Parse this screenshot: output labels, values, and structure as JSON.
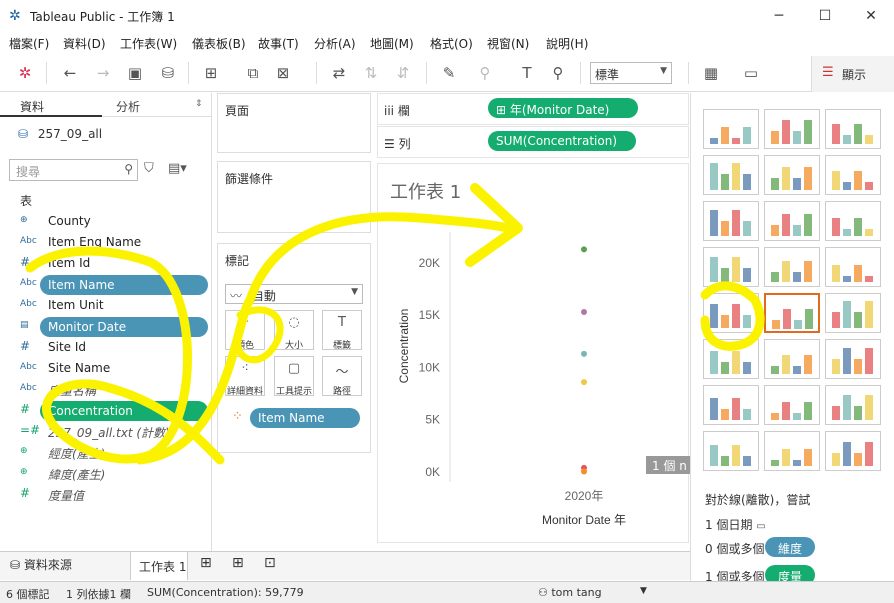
{
  "window": {
    "title": "Tableau Public - 工作簿 1"
  },
  "menu": [
    "檔案(F)",
    "資料(D)",
    "工作表(W)",
    "儀表板(B)",
    "故事(T)",
    "分析(A)",
    "地圖(M)",
    "格式(O)",
    "視窗(N)",
    "說明(H)"
  ],
  "toolbar": {
    "standard": "標準",
    "show_me": "顯示"
  },
  "left": {
    "tab_data": "資料",
    "tab_analysis": "分析",
    "datasource": "257_09_all",
    "search_placeholder": "搜尋",
    "table_header": "表",
    "fields": [
      {
        "icon": "⊕",
        "label": "County",
        "italic": false,
        "type": "geo"
      },
      {
        "icon": "Abc",
        "label": "Item Eng Name",
        "italic": false,
        "type": "dim"
      },
      {
        "icon": "#",
        "label": "Item Id",
        "italic": false,
        "type": "dim"
      },
      {
        "icon": "Abc",
        "label": "Item Name",
        "italic": false,
        "type": "dim",
        "pill": "blue"
      },
      {
        "icon": "Abc",
        "label": "Item Unit",
        "italic": false,
        "type": "dim"
      },
      {
        "icon": "▤",
        "label": "Monitor Date",
        "italic": false,
        "type": "date",
        "pill": "blue"
      },
      {
        "icon": "#",
        "label": "Site Id",
        "italic": false,
        "type": "dim"
      },
      {
        "icon": "Abc",
        "label": "Site Name",
        "italic": false,
        "type": "dim"
      },
      {
        "icon": "Abc",
        "label": "度量名稱",
        "italic": true,
        "type": "dim"
      },
      {
        "icon": "#",
        "label": "Concentration",
        "italic": false,
        "type": "measure",
        "pill": "green"
      },
      {
        "icon": "=#",
        "label": "257_09_all.txt (計數)",
        "italic": true,
        "type": "measure"
      },
      {
        "icon": "⊕",
        "label": "經度(產生)",
        "italic": true,
        "type": "measure"
      },
      {
        "icon": "⊕",
        "label": "緯度(產生)",
        "italic": true,
        "type": "measure"
      },
      {
        "icon": "#",
        "label": "度量值",
        "italic": true,
        "type": "measure"
      }
    ]
  },
  "cards": {
    "pages": "頁面",
    "filters": "篩選條件",
    "marks": "標記",
    "mark_type": "自動",
    "mark_buttons": [
      "顏色",
      "大小",
      "標籤",
      "詳細資料",
      "工具提示",
      "路徑"
    ],
    "color_pill": "Item Name"
  },
  "shelves": {
    "columns_label": "欄",
    "columns_pill": "年(Monitor Date)",
    "rows_label": "列",
    "rows_pill": "SUM(Concentration)"
  },
  "viz": {
    "title": "工作表 1",
    "overlay_label": "1 個 n"
  },
  "chart_data": {
    "type": "scatter",
    "title": "工作表 1",
    "xlabel": "Monitor Date 年",
    "ylabel": "Concentration",
    "x_categories": [
      "2020年"
    ],
    "yticks": [
      "0K",
      "5K",
      "10K",
      "15K",
      "20K"
    ],
    "ylim": [
      0,
      22000
    ],
    "points": [
      {
        "x": "2020年",
        "y": 21300,
        "color": "#59a14f"
      },
      {
        "x": "2020年",
        "y": 15300,
        "color": "#b07aa1"
      },
      {
        "x": "2020年",
        "y": 11300,
        "color": "#76b7b2"
      },
      {
        "x": "2020年",
        "y": 8600,
        "color": "#edc948"
      },
      {
        "x": "2020年",
        "y": 400,
        "color": "#e15759"
      },
      {
        "x": "2020年",
        "y": 50,
        "color": "#f28e2b"
      }
    ]
  },
  "showme": {
    "hint_title": "對於線(離散)，嘗試",
    "hint_1": "1 個日期",
    "hint_2_prefix": "0 個或多個",
    "hint_2_pill": "維度",
    "hint_3_prefix": "1 個或多個",
    "hint_3_pill": "度量"
  },
  "bottom": {
    "datasource_tab": "資料來源",
    "sheet_tab": "工作表 1"
  },
  "status": {
    "marks": "6 個標記",
    "rows_cols": "1 列依據1 欄",
    "sum": "SUM(Concentration): 59,779",
    "user": "tom tang"
  }
}
